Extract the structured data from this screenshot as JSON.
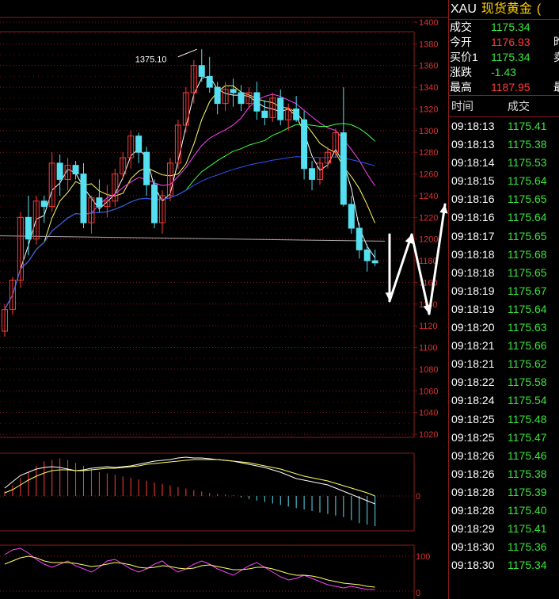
{
  "header": {
    "symbol": "XAU",
    "name": "现货黄金",
    "extra": "("
  },
  "quote": [
    {
      "label": "成交",
      "value": "1175.34",
      "color": "#39e639",
      "cut": ""
    },
    {
      "label": "今开",
      "value": "1176.93",
      "color": "#ff3b3b",
      "cut": "昨"
    },
    {
      "label": "买价1",
      "value": "1175.34",
      "color": "#39e639",
      "cut": "卖"
    },
    {
      "label": "涨跌",
      "value": "-1.43",
      "color": "#39e639",
      "cut": ""
    },
    {
      "label": "最高",
      "value": "1187.95",
      "color": "#ff3b3b",
      "cut": "最"
    }
  ],
  "ticks_header": {
    "time": "时间",
    "price": "成交"
  },
  "ticks": [
    [
      "09:18:13",
      "1175.41"
    ],
    [
      "09:18:13",
      "1175.38"
    ],
    [
      "09:18:14",
      "1175.53"
    ],
    [
      "09:18:15",
      "1175.64"
    ],
    [
      "09:18:16",
      "1175.65"
    ],
    [
      "09:18:16",
      "1175.64"
    ],
    [
      "09:18:17",
      "1175.65"
    ],
    [
      "09:18:18",
      "1175.68"
    ],
    [
      "09:18:18",
      "1175.65"
    ],
    [
      "09:18:19",
      "1175.67"
    ],
    [
      "09:18:19",
      "1175.64"
    ],
    [
      "09:18:20",
      "1175.63"
    ],
    [
      "09:18:21",
      "1175.66"
    ],
    [
      "09:18:21",
      "1175.62"
    ],
    [
      "09:18:22",
      "1175.58"
    ],
    [
      "09:18:24",
      "1175.54"
    ],
    [
      "09:18:25",
      "1175.48"
    ],
    [
      "09:18:25",
      "1175.47"
    ],
    [
      "09:18:26",
      "1175.46"
    ],
    [
      "09:18:26",
      "1175.38"
    ],
    [
      "09:18:28",
      "1175.39"
    ],
    [
      "09:18:28",
      "1175.40"
    ],
    [
      "09:18:29",
      "1175.41"
    ],
    [
      "09:18:30",
      "1175.36"
    ],
    [
      "09:18:30",
      "1175.34"
    ]
  ],
  "chart_data": {
    "type": "candlestick",
    "y_ticks": [
      "1400",
      "1380",
      "1360",
      "1340",
      "1320",
      "1300",
      "1280",
      "1260",
      "1240",
      "1220",
      "1200",
      "1180",
      "1160",
      "1140",
      "1120",
      "1100",
      "1080",
      "1060",
      "1040",
      "1020"
    ],
    "ylim": [
      1020,
      1400
    ],
    "peak_annotation": "1375.10",
    "candles": [
      [
        1115,
        1140,
        1110,
        1135
      ],
      [
        1135,
        1165,
        1130,
        1162
      ],
      [
        1162,
        1225,
        1155,
        1220
      ],
      [
        1220,
        1240,
        1185,
        1200
      ],
      [
        1200,
        1240,
        1195,
        1235
      ],
      [
        1235,
        1240,
        1215,
        1230
      ],
      [
        1230,
        1280,
        1225,
        1270
      ],
      [
        1270,
        1278,
        1240,
        1255
      ],
      [
        1255,
        1275,
        1245,
        1268
      ],
      [
        1268,
        1272,
        1255,
        1260
      ],
      [
        1260,
        1270,
        1210,
        1215
      ],
      [
        1215,
        1240,
        1205,
        1238
      ],
      [
        1238,
        1255,
        1225,
        1230
      ],
      [
        1230,
        1250,
        1220,
        1235
      ],
      [
        1235,
        1265,
        1230,
        1260
      ],
      [
        1260,
        1280,
        1255,
        1275
      ],
      [
        1275,
        1300,
        1265,
        1295
      ],
      [
        1295,
        1298,
        1270,
        1280
      ],
      [
        1280,
        1285,
        1240,
        1250
      ],
      [
        1250,
        1255,
        1210,
        1215
      ],
      [
        1215,
        1245,
        1205,
        1240
      ],
      [
        1240,
        1275,
        1235,
        1270
      ],
      [
        1270,
        1310,
        1265,
        1305
      ],
      [
        1305,
        1340,
        1298,
        1335
      ],
      [
        1335,
        1365,
        1325,
        1360
      ],
      [
        1360,
        1375,
        1345,
        1350
      ],
      [
        1350,
        1368,
        1335,
        1340
      ],
      [
        1340,
        1345,
        1315,
        1325
      ],
      [
        1325,
        1345,
        1318,
        1338
      ],
      [
        1338,
        1348,
        1322,
        1335
      ],
      [
        1335,
        1342,
        1318,
        1325
      ],
      [
        1325,
        1340,
        1320,
        1335
      ],
      [
        1335,
        1345,
        1310,
        1318
      ],
      [
        1318,
        1328,
        1305,
        1312
      ],
      [
        1312,
        1335,
        1308,
        1330
      ],
      [
        1330,
        1338,
        1305,
        1310
      ],
      [
        1310,
        1325,
        1300,
        1320
      ],
      [
        1320,
        1332,
        1308,
        1310
      ],
      [
        1310,
        1318,
        1255,
        1265
      ],
      [
        1265,
        1272,
        1245,
        1255
      ],
      [
        1255,
        1275,
        1250,
        1270
      ],
      [
        1270,
        1285,
        1265,
        1280
      ],
      [
        1280,
        1302,
        1275,
        1298
      ],
      [
        1298,
        1340,
        1230,
        1232
      ],
      [
        1232,
        1240,
        1205,
        1210
      ],
      [
        1210,
        1215,
        1182,
        1190
      ],
      [
        1190,
        1195,
        1170,
        1180
      ],
      [
        1180,
        1190,
        1175,
        1178
      ]
    ],
    "upper_arrows": [
      [
        492,
        296,
        492,
        380
      ],
      [
        492,
        380,
        520,
        296
      ],
      [
        520,
        296,
        542,
        396
      ],
      [
        542,
        396,
        562,
        258
      ]
    ],
    "right_arrows": [
      [
        568,
        282,
        588,
        330
      ],
      [
        588,
        330,
        602,
        268
      ],
      [
        602,
        268,
        612,
        438
      ],
      [
        612,
        438,
        622,
        368
      ],
      [
        622,
        368,
        636,
        410
      ],
      [
        636,
        410,
        678,
        226
      ]
    ],
    "macd_zero_label": "0",
    "kdj_labels": [
      "100",
      "0"
    ]
  }
}
